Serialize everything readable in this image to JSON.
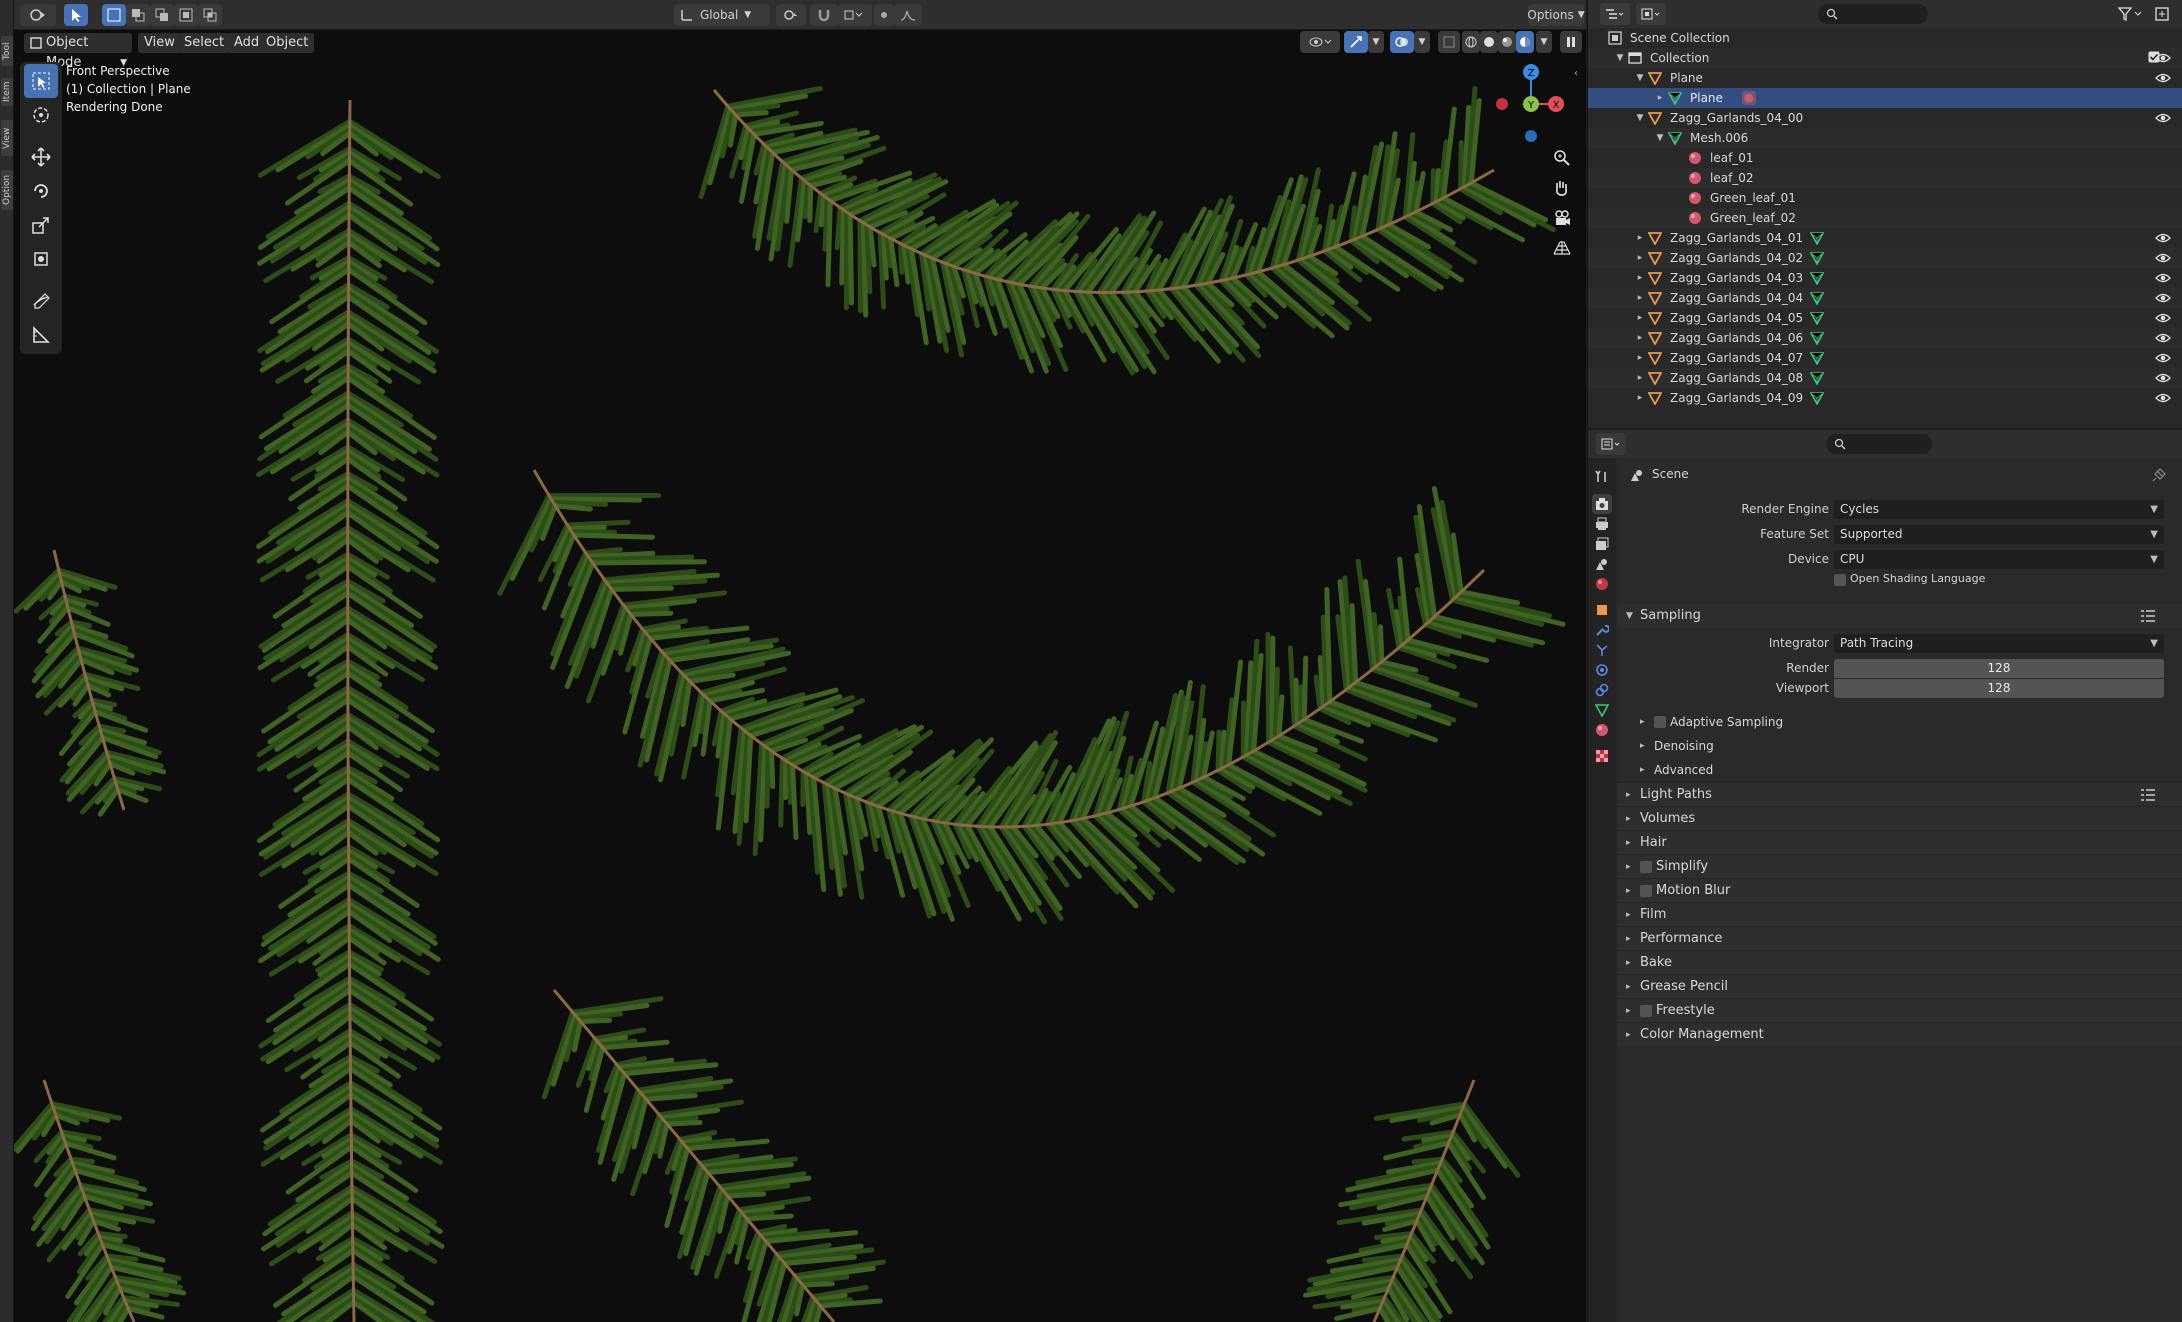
{
  "viewport": {
    "mode_label": "Object Mode",
    "menu": [
      "View",
      "Select",
      "Add",
      "Object"
    ],
    "transform_orientation": "Global",
    "options_label": "Options",
    "info_lines": [
      "Front Perspective",
      "(1) Collection | Plane",
      "Rendering Done"
    ],
    "gizmo_axes": {
      "z": "Z",
      "y": "Y",
      "x": "X"
    }
  },
  "outliner": {
    "rows": [
      {
        "label": "Scene Collection",
        "type": "scene",
        "indent": 0,
        "tri": ""
      },
      {
        "label": "Collection",
        "type": "collection",
        "indent": 1,
        "tri": "▼"
      },
      {
        "label": "Plane",
        "type": "object",
        "indent": 2,
        "tri": "▼"
      },
      {
        "label": "Plane",
        "type": "mesh",
        "indent": 3,
        "tri": "▸",
        "selected": true
      },
      {
        "label": "Zagg_Garlands_04_00",
        "type": "object",
        "indent": 2,
        "tri": "▼"
      },
      {
        "label": "Mesh.006",
        "type": "mesh",
        "indent": 3,
        "tri": "▼"
      },
      {
        "label": "leaf_01",
        "type": "material",
        "indent": 4,
        "tri": ""
      },
      {
        "label": "leaf_02",
        "type": "material",
        "indent": 4,
        "tri": ""
      },
      {
        "label": "Green_leaf_01",
        "type": "material",
        "indent": 4,
        "tri": ""
      },
      {
        "label": "Green_leaf_02",
        "type": "material",
        "indent": 4,
        "tri": ""
      },
      {
        "label": "Zagg_Garlands_04_01",
        "type": "object",
        "indent": 2,
        "tri": "▸"
      },
      {
        "label": "Zagg_Garlands_04_02",
        "type": "object",
        "indent": 2,
        "tri": "▸"
      },
      {
        "label": "Zagg_Garlands_04_03",
        "type": "object",
        "indent": 2,
        "tri": "▸"
      },
      {
        "label": "Zagg_Garlands_04_04",
        "type": "object",
        "indent": 2,
        "tri": "▸"
      },
      {
        "label": "Zagg_Garlands_04_05",
        "type": "object",
        "indent": 2,
        "tri": "▸"
      },
      {
        "label": "Zagg_Garlands_04_06",
        "type": "object",
        "indent": 2,
        "tri": "▸"
      },
      {
        "label": "Zagg_Garlands_04_07",
        "type": "object",
        "indent": 2,
        "tri": "▸"
      },
      {
        "label": "Zagg_Garlands_04_08",
        "type": "object",
        "indent": 2,
        "tri": "▸"
      },
      {
        "label": "Zagg_Garlands_04_09",
        "type": "object",
        "indent": 2,
        "tri": "▸"
      }
    ]
  },
  "properties": {
    "context_title": "Scene",
    "render_engine_label": "Render Engine",
    "render_engine_value": "Cycles",
    "feature_set_label": "Feature Set",
    "feature_set_value": "Supported",
    "device_label": "Device",
    "device_value": "CPU",
    "osl_label": "Open Shading Language",
    "sampling": {
      "title": "Sampling",
      "integrator_label": "Integrator",
      "integrator_value": "Path Tracing",
      "render_label": "Render",
      "render_value": "128",
      "viewport_label": "Viewport",
      "viewport_value": "128",
      "subpanels": [
        "Adaptive Sampling",
        "Denoising",
        "Advanced"
      ]
    },
    "panels": [
      "Light Paths",
      "Volumes",
      "Hair",
      "Simplify",
      "Motion Blur",
      "Film",
      "Performance",
      "Bake",
      "Grease Pencil",
      "Freestyle",
      "Color Management"
    ]
  },
  "colors": {
    "accent": "#4772b3",
    "selected_row": "#334d80",
    "object_orange": "#e99a4e",
    "mesh_green": "#3ec47a",
    "material_red": "#d0586c",
    "axis_x": "#e64d5a",
    "axis_y": "#8bc34a",
    "axis_z": "#3d8be0"
  }
}
